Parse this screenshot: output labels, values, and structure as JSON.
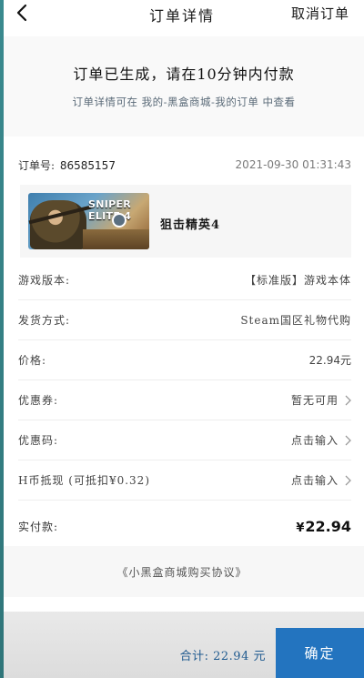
{
  "nav": {
    "title": "订单详情",
    "cancel_label": "取消订单"
  },
  "notice": {
    "main": "订单已生成，请在10分钟内付款",
    "sub": "订单详情可在 我的-黑盒商城-我的订单 中查看"
  },
  "order": {
    "label": "订单号:",
    "number": "86585157",
    "time": "2021-09-30 01:31:43"
  },
  "game": {
    "cover_logo": "SNIPER ELITE 4",
    "name": "狙击精英4"
  },
  "rows": [
    {
      "key": "游戏版本:",
      "value": "【标准版】游戏本体"
    },
    {
      "key": "发货方式:",
      "value": "Steam国区礼物代购"
    },
    {
      "key": "价格:",
      "value": "22.94元"
    },
    {
      "key": "优惠券:",
      "value": "暂无可用"
    },
    {
      "key": "优惠码:",
      "value": "点击输入"
    },
    {
      "key": "H币抵现 (可抵扣¥0.32)",
      "value": "点击输入"
    }
  ],
  "paid": {
    "label": "实付款:",
    "currency": "¥",
    "amount": "22.94"
  },
  "agreement": "《小黑盒商城购买协议》",
  "footer": {
    "total": "合计: 22.94 元",
    "confirm_label": "确定"
  },
  "icons": {
    "back": "chevron-left-icon",
    "arrow": "chevron-right-icon"
  },
  "colors": {
    "accent": "#2374bf",
    "total_text": "#1f5a8f"
  }
}
